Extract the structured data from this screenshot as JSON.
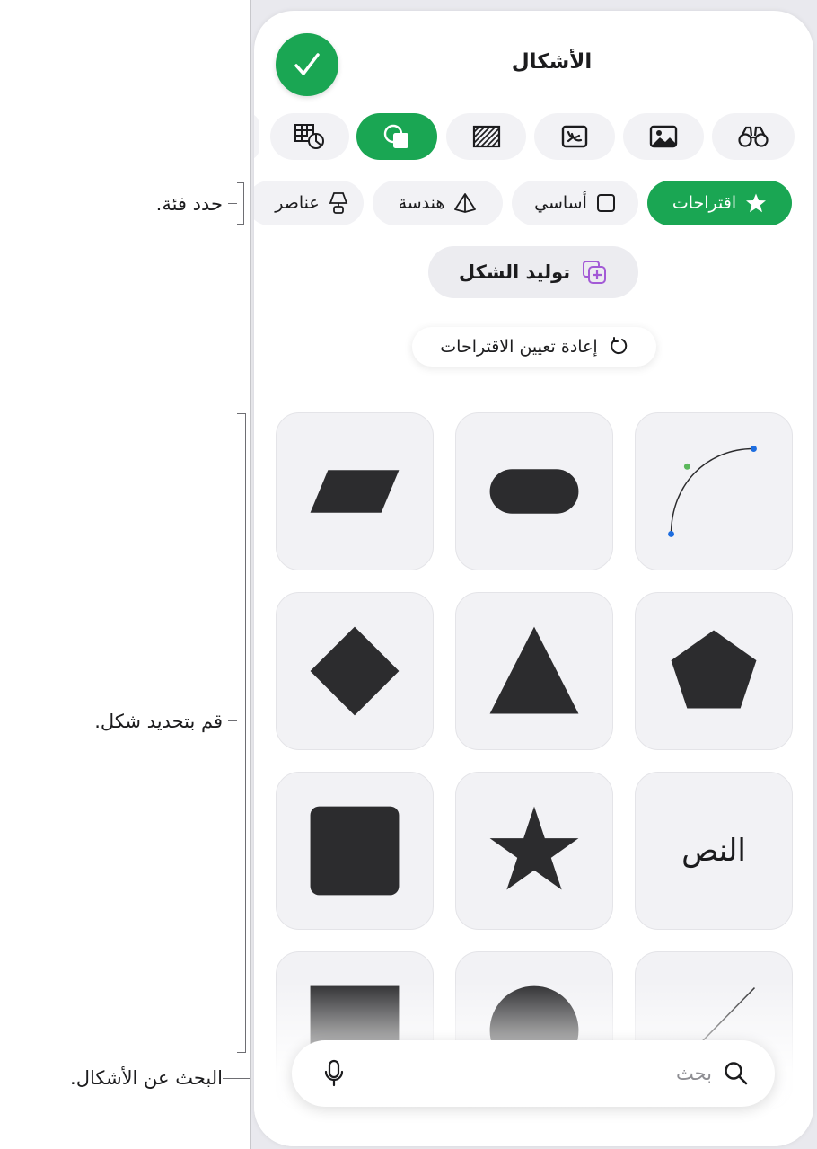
{
  "panel": {
    "title": "الأشكال",
    "tabs": [
      {
        "name": "objects-tab",
        "icon": "binoculars-icon",
        "active": false
      },
      {
        "name": "photos-tab",
        "icon": "photo-icon",
        "active": false
      },
      {
        "name": "sticker-tab",
        "icon": "sticker-icon",
        "active": false
      },
      {
        "name": "pattern-tab",
        "icon": "hatched-square-icon",
        "active": false
      },
      {
        "name": "shapes-tab",
        "icon": "shapes-icon",
        "active": true
      },
      {
        "name": "charts-tab",
        "icon": "table-chart-icon",
        "active": false
      }
    ],
    "categories": {
      "suggestions": "اقتراحات",
      "basic": "أساسي",
      "geometry": "هندسة",
      "objects": "عناصر"
    },
    "generate_label": "توليد الشكل",
    "reset_label": "إعادة تعيين الاقتراحات",
    "text_tile_label": "النص",
    "search": {
      "placeholder": "بحث"
    }
  },
  "callouts": {
    "category": "حدد فئة.",
    "shape": "قم بتحديد شكل.",
    "search": "البحث عن الأشكال."
  },
  "colors": {
    "accent": "#1aa653",
    "shape_fill": "#2c2c2e",
    "tile_bg": "#f2f2f5"
  }
}
